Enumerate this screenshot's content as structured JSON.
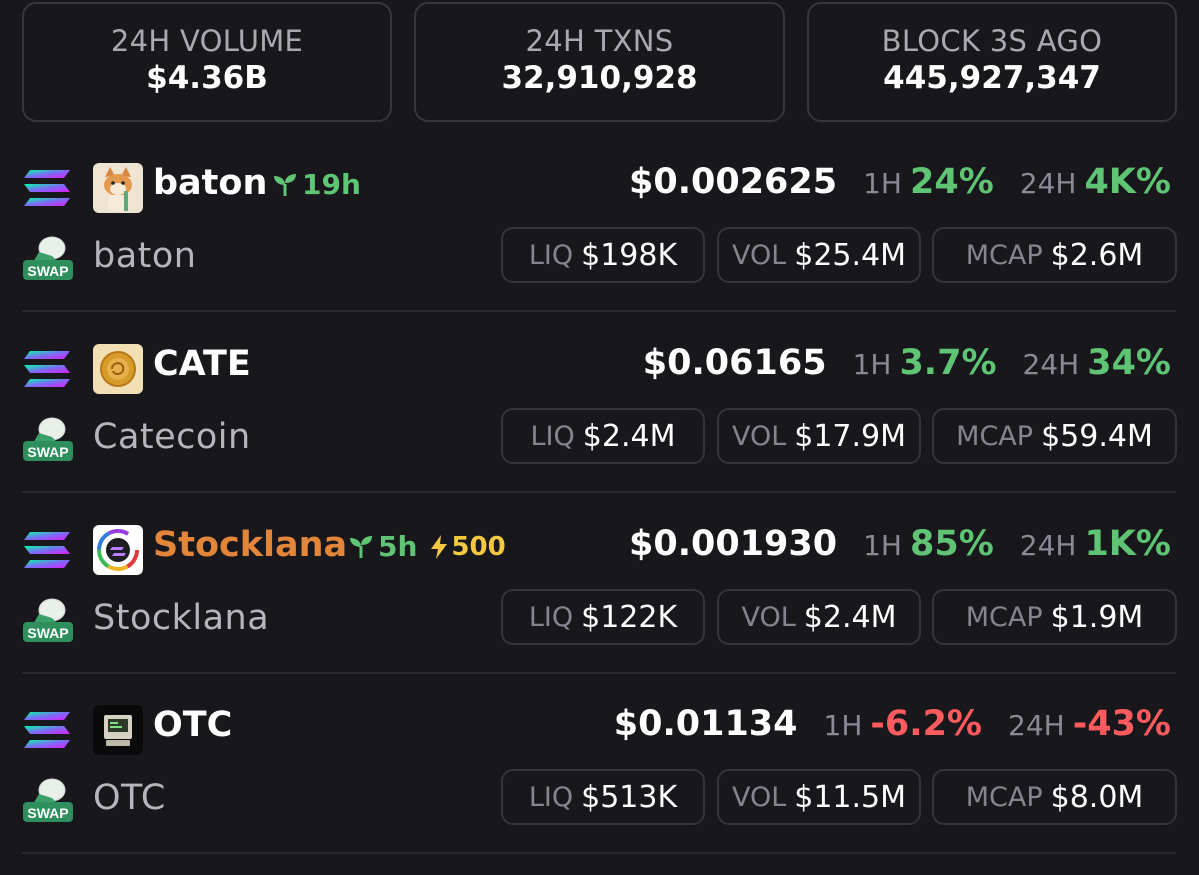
{
  "stats": {
    "volume": {
      "label": "24H VOLUME",
      "value": "$4.36B"
    },
    "txns": {
      "label": "24H TXNS",
      "value": "32,910,928"
    },
    "block": {
      "label": "BLOCK 3S AGO",
      "value": "445,927,347"
    }
  },
  "labels": {
    "h1": "1H",
    "h24": "24H",
    "liq": "LIQ",
    "vol": "VOL",
    "mcap": "MCAP",
    "swap": "SWAP"
  },
  "colors": {
    "up": "#5fc574",
    "down": "#ff5b5f",
    "boost": "#f5c842",
    "highlight_symbol": "#e3863a"
  },
  "tokens": [
    {
      "symbol": "baton",
      "name": "baton",
      "age": "19h",
      "price": "$0.002625",
      "change_1h": "24%",
      "change_24h": "4K%",
      "liq": "$198K",
      "vol": "$25.4M",
      "mcap": "$2.6M",
      "logo_icon": "shiba-dog-icon"
    },
    {
      "symbol": "CATE",
      "name": "Catecoin",
      "price": "$0.06165",
      "change_1h": "3.7%",
      "change_24h": "34%",
      "liq": "$2.4M",
      "vol": "$17.9M",
      "mcap": "$59.4M",
      "logo_icon": "gold-coin-icon"
    },
    {
      "symbol": "Stocklana",
      "name": "Stocklana",
      "age": "5h",
      "boost": "500",
      "price": "$0.001930",
      "change_1h": "85%",
      "change_24h": "1K%",
      "liq": "$122K",
      "vol": "$2.4M",
      "mcap": "$1.9M",
      "logo_icon": "rainbow-ring-icon"
    },
    {
      "symbol": "OTC",
      "name": "OTC",
      "price": "$0.01134",
      "change_1h": "-6.2%",
      "change_24h": "-43%",
      "liq": "$513K",
      "vol": "$11.5M",
      "mcap": "$8.0M",
      "logo_icon": "retro-computer-icon"
    }
  ]
}
